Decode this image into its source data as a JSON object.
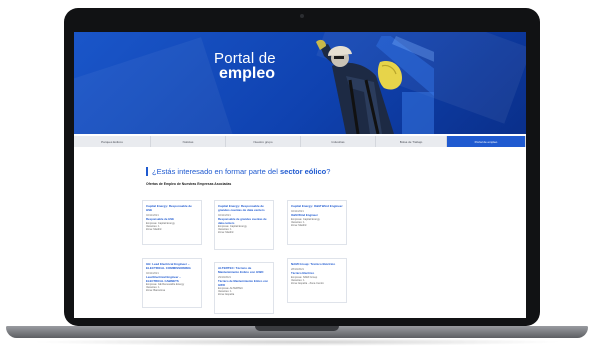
{
  "hero": {
    "title_line1": "Portal de",
    "title_line2": "empleo"
  },
  "nav": {
    "tabs": [
      {
        "label": "Parques Eólicos"
      },
      {
        "label": "Noticias"
      },
      {
        "label": "Nuestro grupo"
      },
      {
        "label": "Industrias"
      },
      {
        "label": "Bolsa de Trabajo"
      },
      {
        "label": "Portal de empleo"
      }
    ],
    "active_index": 5
  },
  "content": {
    "heading_prefix": "¿Estás interesado en formar parte del",
    "heading_highlight": "sector eólico",
    "heading_suffix": "?",
    "subheading": "Ofertas de Empleo de Nuestras Empresas Asociadas"
  },
  "cards": [
    {
      "title": "Capital Energy: Responsable de HSE",
      "date": "02/11/2021",
      "role": "Responsable de HSE",
      "company": "Empresa: Capital Energy",
      "vacancies": "Vacantes: 1",
      "location": "Zona: Madrid"
    },
    {
      "title": "Capital Energy: Responsable de grandes cuentas de data centers",
      "date": "02/11/2021",
      "role": "Responsable de grandes cuentas de data centers",
      "company": "Empresa: Capital Energy",
      "vacancies": "Vacantes: 1",
      "location": "Zona: Madrid"
    },
    {
      "title": "Capital Energy: O&M Wind Engineer",
      "date": "02/11/2021",
      "role": "O&M Wind Engineer",
      "company": "Empresa: Capital Energy",
      "vacancies": "Vacantes: 1",
      "location": "Zona: Madrid"
    },
    {
      "title": "GE: Lead Electrical Engineer – ELECTRICAL COMMISSIONING",
      "date": "02/11/2021",
      "role": "Lead Electrical Engineer – ELECTRICAL CABINETS",
      "company": "Empresa: GE Renewable Energy",
      "vacancies": "Vacantes: 1",
      "location": "Zona: Barcelona"
    },
    {
      "title": "ALTERTEC: Técnico de Mantenimiento Eólico con GWO",
      "date": "29/10/2021",
      "role": "Técnico de Mantenimiento Eólico con GWO",
      "company": "Empresa: ALTERTEC",
      "vacancies": "Vacantes: 1",
      "location": "Zona: España"
    },
    {
      "title": "SIEMENS GAMESA: Técnico SCADA",
      "date": "28/10/2021",
      "role": "Técnico SCADA",
      "company": "Empresa: Siemens Gamesa",
      "vacancies": "Vacantes: 1",
      "location": "Zona: Madrid"
    },
    {
      "title": "NAMI Group: Técnico Eléctrico",
      "date": "28/10/2021",
      "role": "Técnico Eléctrico",
      "company": "Empresa: NAMI Group",
      "vacancies": "Vacantes: 1",
      "location": "Zona: España - Zona Centro"
    }
  ]
}
